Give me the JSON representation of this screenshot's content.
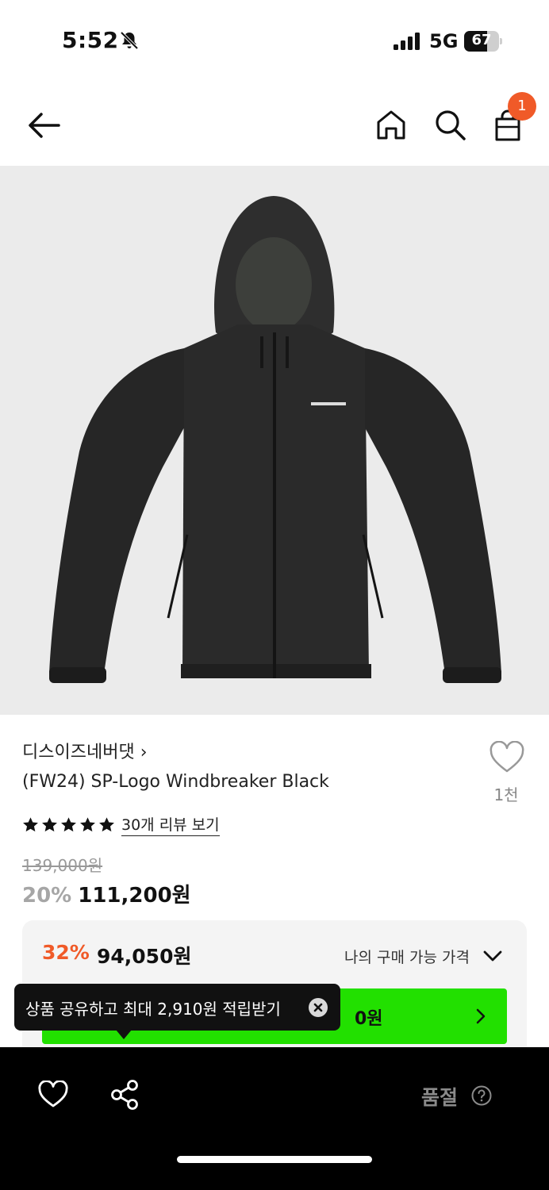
{
  "status_bar": {
    "time": "5:52",
    "network": "5G",
    "battery_level": "67",
    "battery_fraction": 0.67
  },
  "nav": {
    "cart_count": "1",
    "icons": [
      "back-arrow-icon",
      "home-icon",
      "search-icon",
      "shopping-bag-icon"
    ]
  },
  "product": {
    "brand": "디스이즈네버댓",
    "title": "(FW24) SP-Logo Windbreaker Black",
    "rating_stars": 5,
    "review_link": "30개 리뷰 보기",
    "original_price": "139,000원",
    "discount_rate": "20%",
    "sale_price": "111,200원",
    "wishlist_count": "1천"
  },
  "member_price": {
    "discount_rate": "32%",
    "price": "94,050원",
    "toggle_label": "나의 구매 가능 가격",
    "coupon_price_partial": "0원"
  },
  "tooltip": {
    "text": "상품 공유하고 최대 2,910원 적립받기"
  },
  "bottom_bar": {
    "soldout_label": "품절"
  },
  "colors": {
    "accent_orange": "#f05a28",
    "coupon_green": "#22e000",
    "image_background": "#ebebeb",
    "jacket": "#2a2a2a"
  }
}
